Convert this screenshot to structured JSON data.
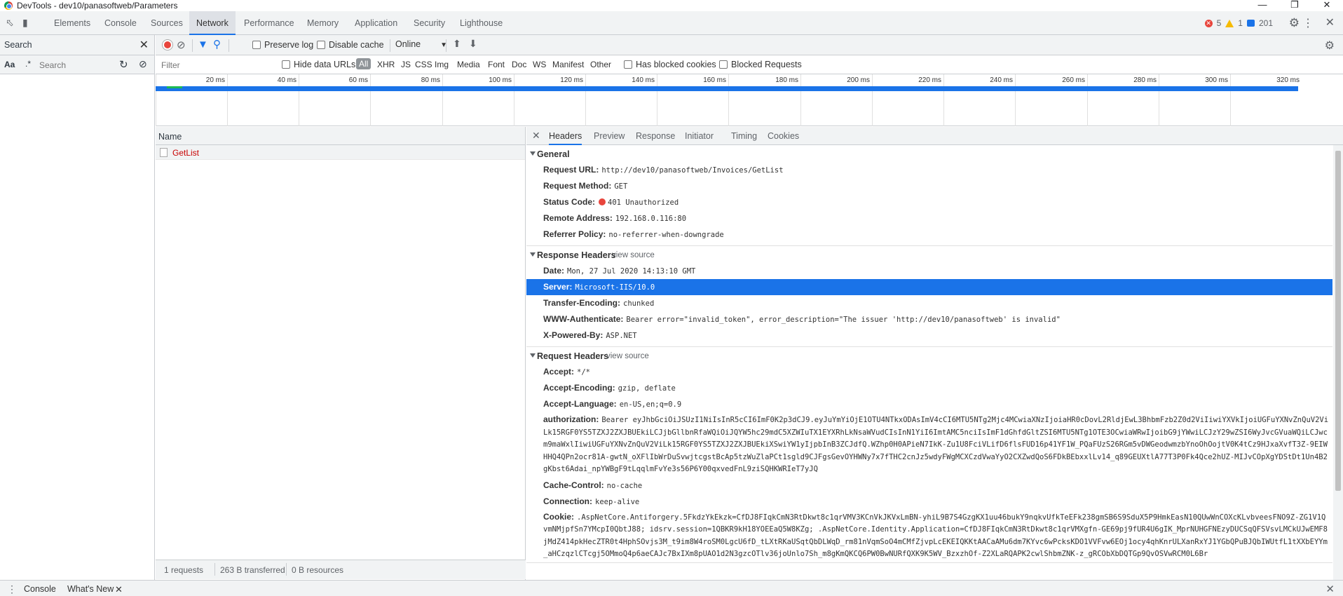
{
  "window": {
    "title": "DevTools - dev10/panasoftweb/Parameters"
  },
  "tabs": [
    "Elements",
    "Console",
    "Sources",
    "Network",
    "Performance",
    "Memory",
    "Application",
    "Security",
    "Lighthouse"
  ],
  "counters": {
    "errors": "5",
    "warnings": "1",
    "messages": "201"
  },
  "search": {
    "title": "Search",
    "placeholder": "Search",
    "match_case": "Aa",
    "regex": ".*"
  },
  "toolbar": {
    "preserve_log": "Preserve log",
    "disable_cache": "Disable cache",
    "throttle": "Online"
  },
  "filterbar": {
    "placeholder": "Filter",
    "hide_data_urls": "Hide data URLs",
    "types": [
      "All",
      "XHR",
      "JS",
      "CSS",
      "Img",
      "Media",
      "Font",
      "Doc",
      "WS",
      "Manifest",
      "Other"
    ],
    "blocked_cookies": "Has blocked cookies",
    "blocked_requests": "Blocked Requests"
  },
  "timeline": {
    "ticks": [
      "20 ms",
      "40 ms",
      "60 ms",
      "80 ms",
      "100 ms",
      "120 ms",
      "140 ms",
      "160 ms",
      "180 ms",
      "200 ms",
      "220 ms",
      "240 ms",
      "260 ms",
      "280 ms",
      "300 ms",
      "320 ms"
    ]
  },
  "requests": {
    "header": "Name",
    "rows": [
      "GetList"
    ]
  },
  "status": {
    "requests": "1 requests",
    "transferred": "263 B transferred",
    "resources": "0 B resources"
  },
  "detail_tabs": [
    "Headers",
    "Preview",
    "Response",
    "Initiator",
    "Timing",
    "Cookies"
  ],
  "general": {
    "title": "General",
    "rows": [
      {
        "k": "Request URL:",
        "v": "http://dev10/panasoftweb/Invoices/GetList"
      },
      {
        "k": "Request Method:",
        "v": "GET"
      },
      {
        "k": "Status Code:",
        "v": "401 Unauthorized"
      },
      {
        "k": "Remote Address:",
        "v": "192.168.0.116:80"
      },
      {
        "k": "Referrer Policy:",
        "v": "no-referrer-when-downgrade"
      }
    ]
  },
  "response_headers": {
    "title": "Response Headers",
    "view_source": "view source",
    "rows": [
      {
        "k": "Date:",
        "v": "Mon, 27 Jul 2020 14:13:10 GMT"
      },
      {
        "k": "Server:",
        "v": "Microsoft-IIS/10.0"
      },
      {
        "k": "Transfer-Encoding:",
        "v": "chunked"
      },
      {
        "k": "WWW-Authenticate:",
        "v": "Bearer error=\"invalid_token\", error_description=\"The issuer 'http://dev10/panasoftweb' is invalid\""
      },
      {
        "k": "X-Powered-By:",
        "v": "ASP.NET"
      }
    ]
  },
  "request_headers": {
    "title": "Request Headers",
    "view_source": "view source",
    "rows": [
      {
        "k": "Accept:",
        "v": "*/*"
      },
      {
        "k": "Accept-Encoding:",
        "v": "gzip, deflate"
      },
      {
        "k": "Accept-Language:",
        "v": "en-US,en;q=0.9"
      },
      {
        "k": "authorization:",
        "v": "Bearer eyJhbGciOiJSUzI1NiIsInR5cCI6ImF0K2p3dCJ9.eyJuYmYiOjE1OTU4NTkxODAsImV4cCI6MTU5NTg2Mjc4MCwiaXNzIjoiaHR0cDovL2RldjEwL3BhbmFzb2Z0d2ViIiwiYXVkIjoiUGFuYXNvZnQuV2ViLk15RGF0YS5TZXJ2ZXJBUEkiLCJjbGllbnRfaWQiOiJQYW5hc29mdC5XZWIuTX1EYXRhLkNsaWVudCIsInN1YiI6ImtAMC5nciIsImF1dGhfdGltZSI6MTU5NTg1OTE3OCwiaWRwIjoibG9jYWwiLCJzY29wZSI6WyJvcGVuaWQiLCJwcm9maWxlIiwiUGFuYXNvZnQuV2ViLk15RGF0YS5TZXJ2ZXJBUEkiXSwiYW1yIjpbInB3ZCJdfQ.WZhp0H0APieN7IkK-Zu1U8FciVLifD6flsFUD16p41YF1W_PQaFUzS26RGm5vDWGeodwmzbYnoOhOojtV0K4tCz9HJxaXvfT3Z-9EIWHHQ4QPn2ocr81A-gwtN_oXFlIbWrDuSvwjtcgstBcAp5tzWuZlaPCt1sgld9CJFgsGevOYHWNy7x7fTHC2cnJz5wdyFWgMCXCzdVwaYyO2CXZwdQoS6FDkBEbxxlLv14_q89GEUXtlA77T3P0Fk4Qce2hUZ-MIJvCOpXgYDStDt1Un4B2gKbst6Adai_npYWBgF9tLqqlmFvYe3s56P6Y00qxvedFnL9ziSQHKWRIeT7yJQ"
      },
      {
        "k": "Cache-Control:",
        "v": "no-cache"
      },
      {
        "k": "Connection:",
        "v": "keep-alive"
      },
      {
        "k": "Cookie:",
        "v": ".AspNetCore.Antiforgery.5FkdzYkEkzk=CfDJ8FIqkCmN3RtDkwt8c1qrVMV3KCnVkJKVxLmBN-yhiL9B7S4GzgKX1uu46bukY9nqkvUfkTeEFk238gmSB6S9SduX5P9HmkEasN10QUwWnCOXcKLvbveesFNO9Z-ZG1V1QvmNMjpfSn7YMcpI0QbtJ88; idsrv.session=1QBKR9kH18YOEEaQ5W8KZg; .AspNetCore.Identity.Application=CfDJ8FIqkCmN3RtDkwt8c1qrVMXgfn-GE69pj9fUR4U6gIK_MprNUHGFNEzyDUCSqQFSVsvLMCkUJwEMF8jMdZ414pkHecZTR0t4HphSOvjs3M_t9im8W4roSM0LgcU6fD_tLXtRKaUSqtQbDLWqD_rm81nVqmSoO4mCMfZjvpLcEKEIQKKtAACaAMu6dm7KYvc6wPcksKDO1VVFvw6EOj1ocy4qhKnrULXanRxYJ1YGbQPuBJQbIWUtfL1tXXbEYYm_aHCzqzlCTcgj5OMmoQ4p6aeCAJc7BxIXm8pUAO1d2N3gzcOTlv36joUnlo7Sh_m8gKmQKCQ6PW0BwNURfQXK9K5WV_BzxzhOf-Z2XLaRQAPK2cwlShbmZNK-z_gRCObXbDQTGp9QvOSVwRCM0L6Br"
      }
    ]
  },
  "drawer": {
    "tabs": [
      "Console",
      "What's New"
    ]
  }
}
